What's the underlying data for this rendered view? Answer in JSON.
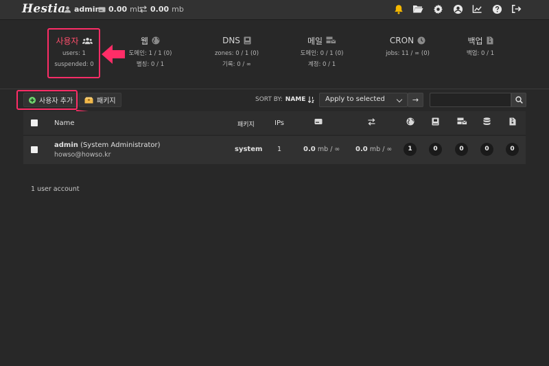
{
  "app": {
    "logo_text": "Hestia",
    "user": "admin",
    "disk_value": "0.00",
    "disk_unit": "mb",
    "bandwidth_value": "0.00",
    "bandwidth_unit": "mb"
  },
  "topnav_icons": [
    "bell-icon",
    "folder-open-icon",
    "gear-icon",
    "user-circle-icon",
    "chart-line-icon",
    "help-icon",
    "logout-icon"
  ],
  "colors": {
    "accent": "#ff2d67",
    "active_title": "#ff4f6d",
    "bell": "#f5b800",
    "add_icon": "#6fd46f",
    "package_icon": "#f2b94a"
  },
  "stats": [
    {
      "title": "사용자",
      "icon": "users-icon",
      "line1": "users: 1",
      "line2": "suspended: 0",
      "active": true
    },
    {
      "title": "웹",
      "icon": "globe-icon",
      "line1": "도메인: 1 / 1 (0)",
      "line2": "별칭: 0 / 1"
    },
    {
      "title": "DNS",
      "icon": "book-icon",
      "line1": "zones: 0 / 1 (0)",
      "line2": "기록: 0 / ∞"
    },
    {
      "title": "메일",
      "icon": "mail-server-icon",
      "line1": "도메인: 0 / 1 (0)",
      "line2": "계정: 0 / 1"
    },
    {
      "title": "CRON",
      "icon": "clock-icon",
      "line1": "jobs: 11 / ∞ (0)",
      "line2": ""
    },
    {
      "title": "백업",
      "icon": "file-archive-icon",
      "line1": "백업: 0 / 1",
      "line2": ""
    }
  ],
  "toolbar": {
    "add_user_label": "사용자 추가",
    "packages_label": "패키지",
    "sort_by_label": "SORT BY:",
    "sort_by_value": "NAME",
    "bulk_action_selected": "Apply to selected",
    "go_label": "→",
    "search_value": ""
  },
  "table": {
    "headers": {
      "name": "Name",
      "package": "패키지",
      "ips": "IPs"
    },
    "header_icons": [
      "disk-icon",
      "transfer-icon",
      "globe-icon",
      "book-icon",
      "mail-server-icon",
      "database-icon",
      "file-archive-icon"
    ],
    "rows": [
      {
        "username": "admin",
        "fullname": "(System Administrator)",
        "email": "howso@howso.kr",
        "package": "system",
        "ips": "1",
        "disk_value": "0.0",
        "disk_unit": "mb / ∞",
        "bandwidth_value": "0.0",
        "bandwidth_unit": "mb / ∞",
        "web": "1",
        "dns": "0",
        "mail": "0",
        "db": "0",
        "backups": "0"
      }
    ]
  },
  "footer": {
    "count_text": "1 user account"
  }
}
